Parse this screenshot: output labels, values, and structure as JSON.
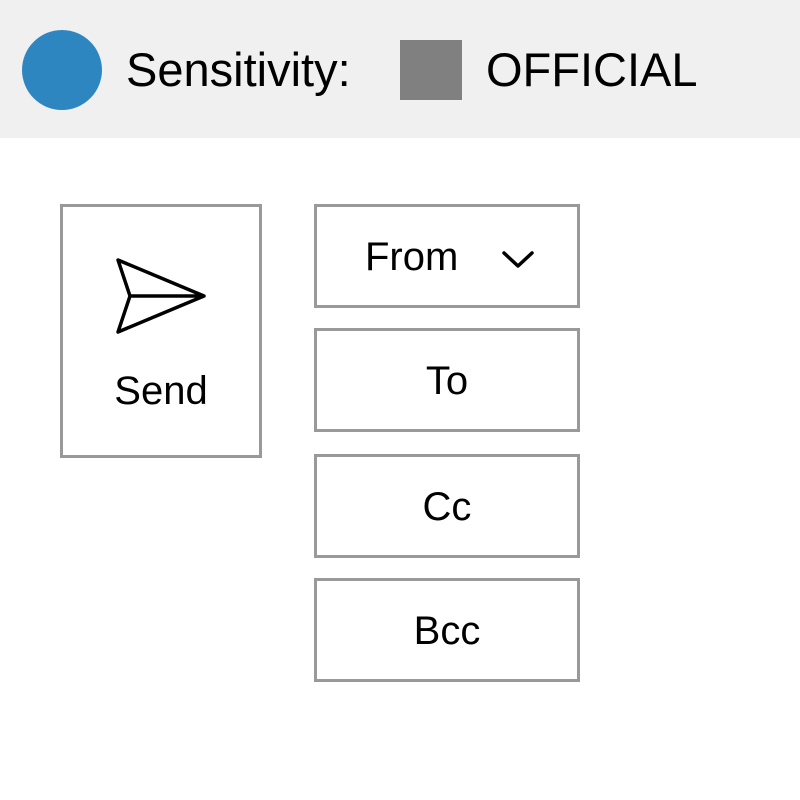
{
  "sensitivity": {
    "label": "Sensitivity:",
    "value": "OFFICIAL",
    "status_color": "#2e86c1",
    "swatch_color": "#808080",
    "swatch_icon": "square-swatch"
  },
  "actions": {
    "send_label": "Send",
    "send_icon": "paper-plane-icon"
  },
  "fields": {
    "from_label": "From",
    "from_icon": "chevron-down-icon",
    "to_label": "To",
    "cc_label": "Cc",
    "bcc_label": "Bcc"
  }
}
